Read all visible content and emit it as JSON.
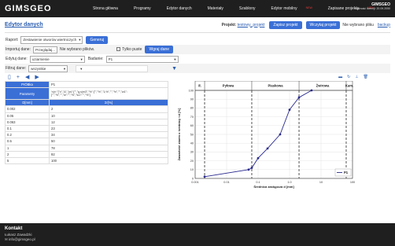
{
  "app": {
    "logo": "GIMSGEO",
    "brand": "GIMSGEO",
    "license": "ważność licencji: 20.09.2050"
  },
  "nav": [
    {
      "label": "Strona główna"
    },
    {
      "label": "Programy"
    },
    {
      "label": "Edytor danych"
    },
    {
      "label": "Materiały"
    },
    {
      "label": "Szablony"
    },
    {
      "label": "Edytor mobilny",
      "badge": "NEW"
    },
    {
      "label": "Zapisane projekty",
      "badge": "NEW"
    }
  ],
  "header": {
    "title": "Edytor danych",
    "project_label": "Projekt:",
    "project_name": "testowy_projekt",
    "save_btn": "Zapisz projekt",
    "load_btn": "Wczytaj projekt",
    "no_file": "Nie wybrano pliku",
    "backup": "backup"
  },
  "report": {
    "label": "Raport:",
    "value": "Zestawienie otworów wiertniczych",
    "button": "Generuj"
  },
  "import": {
    "label": "Importuj dane:",
    "browse": "Przeglądaj...",
    "no_file": "Nie wybrano plików.",
    "only_empty": "Tylko puste",
    "button": "Wgraj dane"
  },
  "edit": {
    "label": "Edytuj dane:",
    "value": "uziarnienie",
    "test_label": "Badanie:",
    "test_value": "P1"
  },
  "filter": {
    "label": "Filtruj dane:",
    "value": "wszystkie"
  },
  "table": {
    "rows_meta": [
      [
        "PrÓBka",
        "P1"
      ],
      [
        "Parametry",
        "'n(x':\"[\"x\",\"Δ\",\"ps\":[\"\",\"g,s|m3\",\"%\":[\"\",\"%\",\"1;%\",\"\",\"%\",\"\",\"w1\":",
        "[\"\",\"%\",\"\",\"w\":\"\",\"%\",\"w1\":\"\",\"%\"}"
      ]
    ],
    "col1": "D[mm]",
    "col2": "Σr[%]",
    "rows": [
      [
        "0.002",
        "2"
      ],
      [
        "0.05",
        "10"
      ],
      [
        "0.063",
        "12"
      ],
      [
        "0.1",
        "23"
      ],
      [
        "0.2",
        "34"
      ],
      [
        "0.5",
        "50"
      ],
      [
        "1",
        "78"
      ],
      [
        "2",
        "92"
      ],
      [
        "5",
        "100"
      ]
    ]
  },
  "chart_data": {
    "type": "line",
    "x": [
      0.002,
      0.05,
      0.063,
      0.1,
      0.2,
      0.5,
      1,
      2,
      5
    ],
    "series": [
      {
        "name": "P1",
        "values": [
          2,
          10,
          12,
          23,
          34,
          50,
          78,
          92,
          100
        ]
      }
    ],
    "xscale": "log",
    "xlim": [
      0.001,
      100
    ],
    "ylim": [
      0,
      100
    ],
    "xticks": [
      "0.001",
      "0.01",
      "0.1",
      "1.0",
      "10",
      "100"
    ],
    "yticks": [
      "0",
      "10",
      "20",
      "30",
      "40",
      "50",
      "60",
      "70",
      "80",
      "90",
      "100"
    ],
    "xlabel": "Średnica zastępcza d [mm]",
    "ylabel": "Zawartość ziaren o średnicy <d [%]",
    "zones": [
      {
        "label": "Ił.",
        "to": 0.002
      },
      {
        "label": "Pyłowa",
        "to": 0.063
      },
      {
        "label": "Piaskowa",
        "to": 2
      },
      {
        "label": "Żwirowa",
        "to": 63
      },
      {
        "label": "Kam.",
        "to": 100
      }
    ],
    "legend": "bottom-right",
    "grid": true
  },
  "footer": {
    "title": "Kontakt",
    "name": "Łukasz Zawadzki",
    "email": "✉ info@gimsgeo.pl"
  }
}
